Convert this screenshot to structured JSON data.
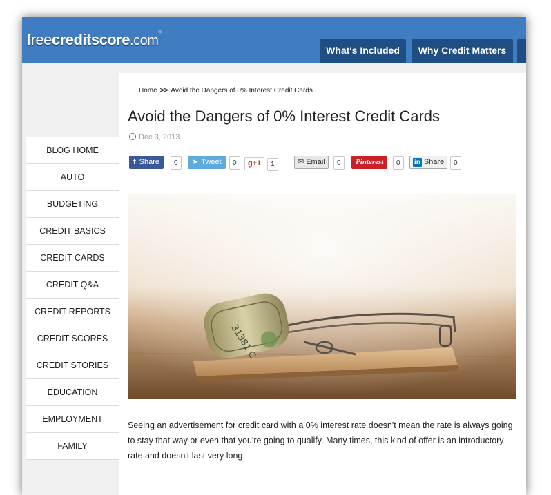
{
  "header": {
    "logo_pre": "free",
    "logo_bold": "creditscore",
    "logo_com": ".com",
    "logo_tm": "®",
    "nav": [
      "What's Included",
      "Why Credit Matters"
    ]
  },
  "sidebar": {
    "items": [
      "BLOG HOME",
      "AUTO",
      "BUDGETING",
      "CREDIT BASICS",
      "CREDIT CARDS",
      "CREDIT Q&A",
      "CREDIT REPORTS",
      "CREDIT SCORES",
      "CREDIT STORIES",
      "EDUCATION",
      "EMPLOYMENT",
      "FAMILY"
    ]
  },
  "breadcrumb": {
    "home": "Home",
    "sep": ">>",
    "current": "Avoid the Dangers of 0% Interest Credit Cards"
  },
  "article": {
    "title": "Avoid the Dangers of 0% Interest Credit Cards",
    "date": "Dec 3, 2013",
    "body": "Seeing an advertisement for credit card with a 0% interest rate doesn't mean the rate is always going to stay that way or even that you're going to qualify. Many times, this kind of offer is an introductory rate and doesn't last very long."
  },
  "shares": {
    "facebook_label": "Share",
    "facebook_icon": "f",
    "facebook_count": "0",
    "twitter_label": "Tweet",
    "twitter_count": "0",
    "gplus_label": "g+1",
    "gplus_count": "1",
    "email_label": "Email",
    "email_count": "0",
    "pinterest_label": "Pinterest",
    "pinterest_count": "0",
    "linkedin_icon": "in",
    "linkedin_label": "Share",
    "linkedin_count": "0"
  },
  "hero": {
    "bill_serial": "31381 C"
  },
  "colors": {
    "header_blue": "#3f7cc2",
    "tab_navy": "#1f4f82",
    "facebook": "#3b5998",
    "twitter": "#5ea9dd",
    "pinterest": "#cb2027"
  }
}
